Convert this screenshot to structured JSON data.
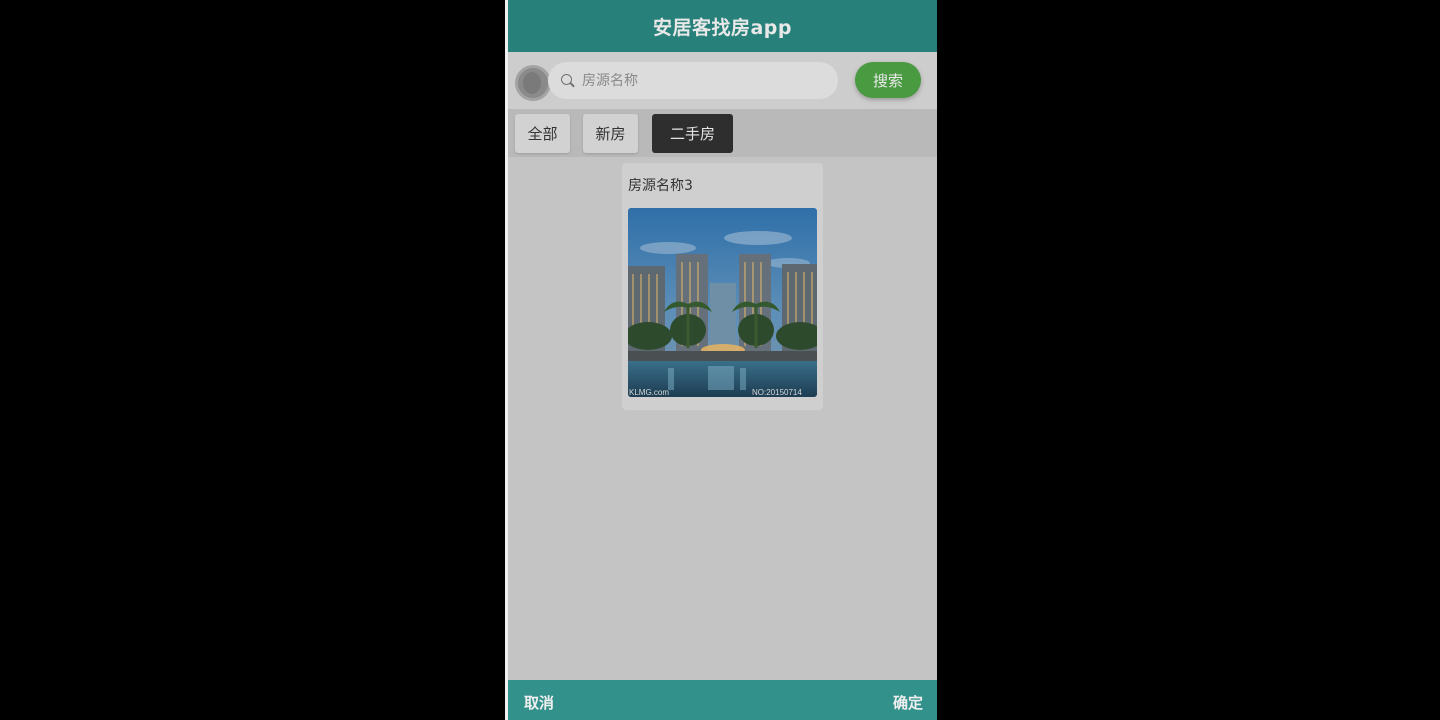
{
  "app": {
    "title": "安居客找房app"
  },
  "search": {
    "placeholder": "房源名称",
    "value": "",
    "button_label": "搜索"
  },
  "tabs": [
    {
      "label": "全部",
      "active": false
    },
    {
      "label": "新房",
      "active": false
    },
    {
      "label": "二手房",
      "active": true
    }
  ],
  "listings": [
    {
      "title": "房源名称3",
      "image": {
        "watermark_left": "KLMG.com",
        "watermark_right": "NO:20150714"
      }
    }
  ],
  "footer": {
    "cancel_label": "取消",
    "confirm_label": "确定"
  },
  "colors": {
    "header": "#27807a",
    "search_button": "#4a9a42",
    "active_tab": "#2e2e2e",
    "footer": "#33918b"
  },
  "icons": {
    "search": "search-icon",
    "avatar": "avatar"
  }
}
